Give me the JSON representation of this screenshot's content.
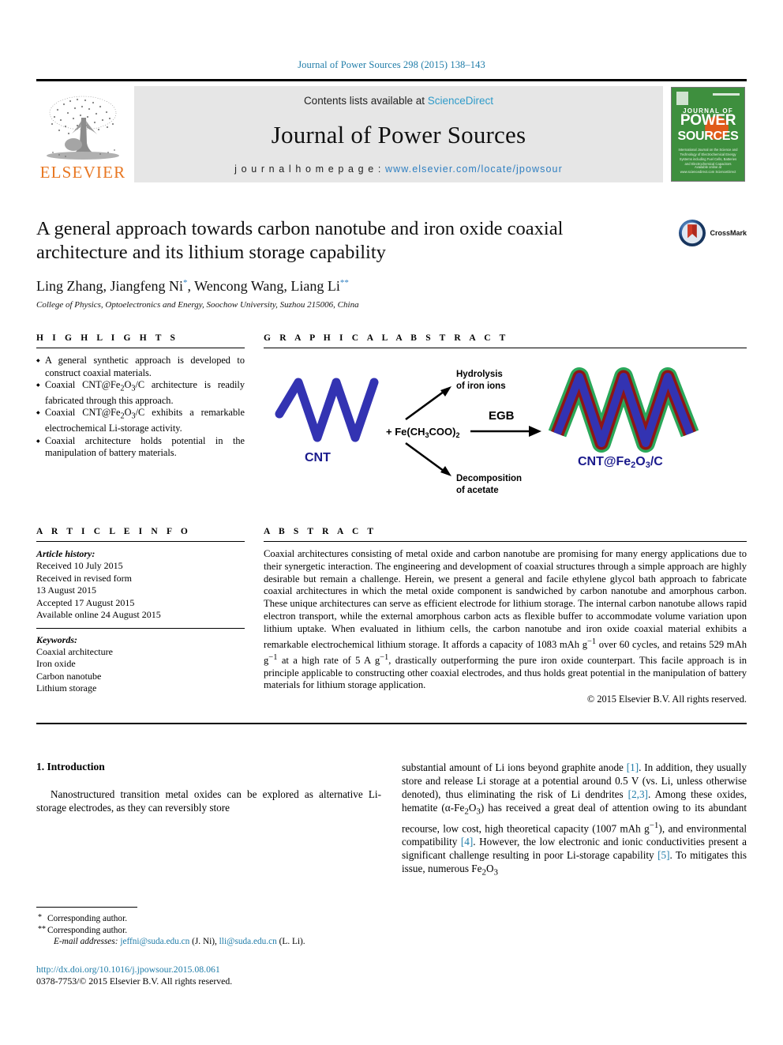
{
  "running_head": "Journal of Power Sources 298 (2015) 138–143",
  "masthead": {
    "contents_prefix": "Contents lists available at ",
    "sciencedirect": "ScienceDirect",
    "journal_name": "Journal of Power Sources",
    "homepage_prefix": "j o u r n a l   h o m e p a g e :   ",
    "homepage_url": "www.elsevier.com/locate/jpowsour",
    "elsevier_wordmark": "ELSEVIER",
    "accent_orange": "#E87722",
    "accent_blue": "#2f7fc1",
    "cover": {
      "line1": "JOURNAL OF",
      "line2": "POWER",
      "line3": "SOURCES",
      "blurb": "International Journal on the Science and Technology of Electrochemical Energy Systems including Fuel Cells, Batteries and Electrochemical Capacitors",
      "footer": "Available online at www.sciencedirect.com ScienceDirect",
      "bg_color": "#3e8f3e",
      "sun_color": "#e05a1a"
    }
  },
  "article": {
    "title": "A general approach towards carbon nanotube and iron oxide coaxial architecture and its lithium storage capability",
    "authors_plain": "Ling Zhang, Jiangfeng Ni",
    "authors_parts": [
      {
        "name": "Ling Zhang, Jiangfeng Ni",
        "mark": "*"
      },
      {
        "name": ", Wencong Wang, Liang Li",
        "mark": "**"
      }
    ],
    "affiliation": "College of Physics, Optoelectronics and Energy, Soochow University, Suzhou 215006, China",
    "crossmark_label": "CrossMark"
  },
  "highlights": {
    "heading": "H I G H L I G H T S",
    "items": [
      "A general synthetic approach is developed to construct coaxial materials.",
      "Coaxial CNT@Fe2O3/C architecture is readily fabricated through this approach.",
      "Coaxial CNT@Fe2O3/C exhibits a remarkable electrochemical Li-storage activity.",
      "Coaxial architecture holds potential in the manipulation of battery materials."
    ]
  },
  "graphical_abstract": {
    "heading": "G R A P H I C A L   A B S T R A C T",
    "cnt_label": "CNT",
    "reagent_label": "+ Fe(CH3COO)2",
    "arrow_top_label_line1": "Hydrolysis",
    "arrow_top_label_line2": "of iron ions",
    "arrow_mid_label": "EGB",
    "arrow_bottom_label_line1": "Decomposition",
    "arrow_bottom_label_line2": "of acetate",
    "product_label": "CNT@Fe2O3/C",
    "colors": {
      "cnt_blue": "#3333b2",
      "shell_green": "#2aa85a",
      "oxide_red": "#8e1616"
    }
  },
  "article_info": {
    "heading": "A R T I C L E   I N F O",
    "history_label": "Article history:",
    "history": [
      "Received 10 July 2015",
      "Received in revised form",
      "13 August 2015",
      "Accepted 17 August 2015",
      "Available online 24 August 2015"
    ],
    "keywords_label": "Keywords:",
    "keywords": [
      "Coaxial architecture",
      "Iron oxide",
      "Carbon nanotube",
      "Lithium storage"
    ]
  },
  "abstract": {
    "heading": "A B S T R A C T",
    "text": "Coaxial architectures consisting of metal oxide and carbon nanotube are promising for many energy applications due to their synergetic interaction. The engineering and development of coaxial structures through a simple approach are highly desirable but remain a challenge. Herein, we present a general and facile ethylene glycol bath approach to fabricate coaxial architectures in which the metal oxide component is sandwiched by carbon nanotube and amorphous carbon. These unique architectures can serve as efficient electrode for lithium storage. The internal carbon nanotube allows rapid electron transport, while the external amorphous carbon acts as flexible buffer to accommodate volume variation upon lithium uptake. When evaluated in lithium cells, the carbon nanotube and iron oxide coaxial material exhibits a remarkable electrochemical lithium storage. It affords a capacity of 1083 mAh g−1 over 60 cycles, and retains 529 mAh g−1 at a high rate of 5 A g−1, drastically outperforming the pure iron oxide counterpart. This facile approach is in principle applicable to constructing other coaxial electrodes, and thus holds great potential in the manipulation of battery materials for lithium storage application.",
    "copyright": "© 2015 Elsevier B.V. All rights reserved."
  },
  "body": {
    "section_number_title": "1.  Introduction",
    "left_paragraph": "Nanostructured transition metal oxides can be explored as alternative Li-storage electrodes, as they can reversibly store",
    "right_paragraph_segments": [
      {
        "t": "substantial amount of Li ions beyond graphite anode "
      },
      {
        "t": "[1]",
        "ref": true
      },
      {
        "t": ". In addition, they usually store and release Li storage at a potential around 0.5 V (vs. Li, unless otherwise denoted), thus eliminating the risk of Li dendrites "
      },
      {
        "t": "[2,3]",
        "ref": true
      },
      {
        "t": ". Among these oxides, hematite (α-Fe2O3) has received a great deal of attention owing to its abundant recourse, low cost, high theoretical capacity (1007 mAh g−1), and environmental compatibility "
      },
      {
        "t": "[4]",
        "ref": true
      },
      {
        "t": ". However, the low electronic and ionic conductivities present a significant challenge resulting in poor Li-storage capability "
      },
      {
        "t": "[5]",
        "ref": true
      },
      {
        "t": ". To mitigates this issue, numerous Fe2O3"
      }
    ]
  },
  "footnotes": {
    "corresponding_1": "Corresponding author.",
    "corresponding_1_mark": "*",
    "corresponding_2": "Corresponding author.",
    "corresponding_2_mark": "**",
    "email_label": "E-mail addresses:",
    "email_1": "jeffni@suda.edu.cn",
    "email_1_owner": "(J. Ni)",
    "email_2": "lli@suda.edu.cn",
    "email_2_owner": "(L. Li)",
    "doi": "http://dx.doi.org/10.1016/j.jpowsour.2015.08.061",
    "issn": "0378-7753/© 2015 Elsevier B.V. All rights reserved."
  }
}
